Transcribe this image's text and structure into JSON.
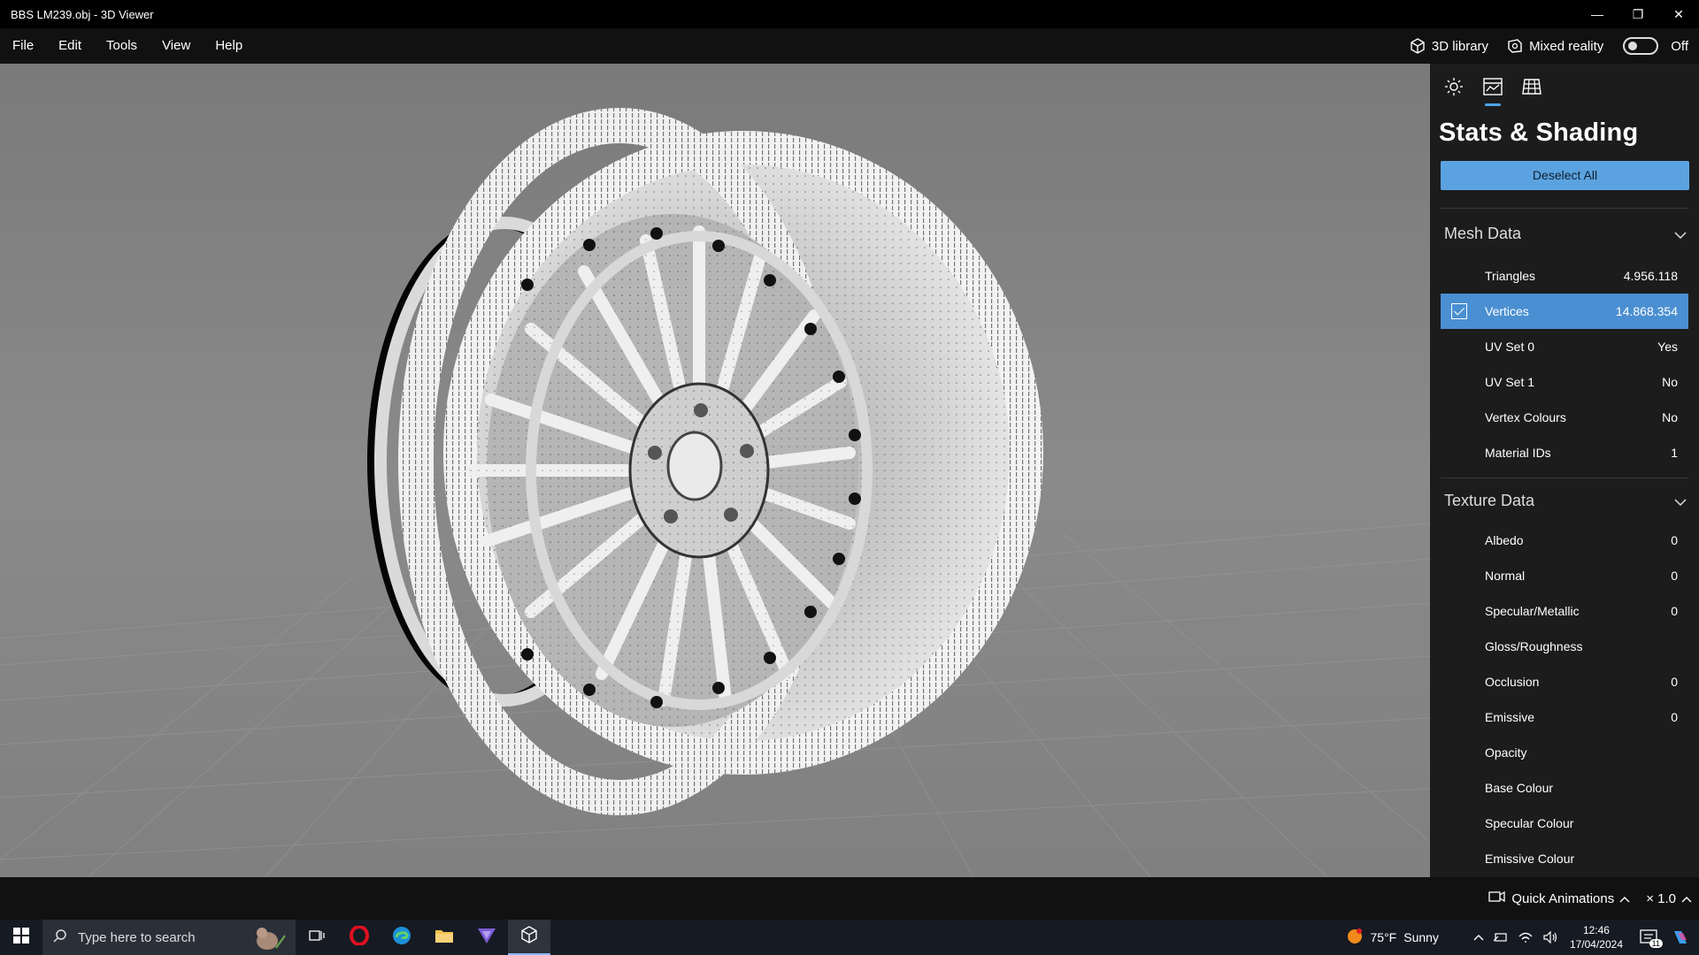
{
  "window": {
    "title": "BBS LM239.obj - 3D Viewer",
    "minimize": "—",
    "restore": "❐",
    "close": "✕"
  },
  "menu": {
    "items": [
      "File",
      "Edit",
      "Tools",
      "View",
      "Help"
    ],
    "library_label": "3D library",
    "mixed_reality_label": "Mixed reality",
    "mixed_reality_state": "Off"
  },
  "panel": {
    "tabs": [
      "lighting-icon",
      "stats-icon",
      "grid-icon"
    ],
    "title": "Stats & Shading",
    "deselect_label": "Deselect All",
    "mesh_section": "Mesh Data",
    "mesh_rows": [
      {
        "label": "Triangles",
        "value": "4.956.118"
      },
      {
        "label": "Vertices",
        "value": "14.868.354"
      },
      {
        "label": "UV Set 0",
        "value": "Yes"
      },
      {
        "label": "UV Set 1",
        "value": "No"
      },
      {
        "label": "Vertex Colours",
        "value": "No"
      },
      {
        "label": "Material IDs",
        "value": "1"
      }
    ],
    "texture_section": "Texture Data",
    "texture_rows": [
      {
        "label": "Albedo",
        "value": "0"
      },
      {
        "label": "Normal",
        "value": "0"
      },
      {
        "label": "Specular/Metallic",
        "value": "0"
      },
      {
        "label": "Gloss/Roughness",
        "value": ""
      },
      {
        "label": "Occlusion",
        "value": "0"
      },
      {
        "label": "Emissive",
        "value": "0"
      },
      {
        "label": "Opacity",
        "value": ""
      },
      {
        "label": "Base Colour",
        "value": ""
      },
      {
        "label": "Specular Colour",
        "value": ""
      },
      {
        "label": "Emissive Colour",
        "value": ""
      }
    ]
  },
  "status": {
    "animations_label": "Quick Animations",
    "speed_label": "× 1.0"
  },
  "taskbar": {
    "search_placeholder": "Type here to search",
    "weather_temp": "75°F",
    "weather_text": "Sunny",
    "time": "12:46",
    "date": "17/04/2024",
    "notification_count": "11"
  },
  "colors": {
    "accent": "#5ba3e0",
    "selected_row": "#4a8fd1",
    "viewport": "#7c7c7c"
  }
}
